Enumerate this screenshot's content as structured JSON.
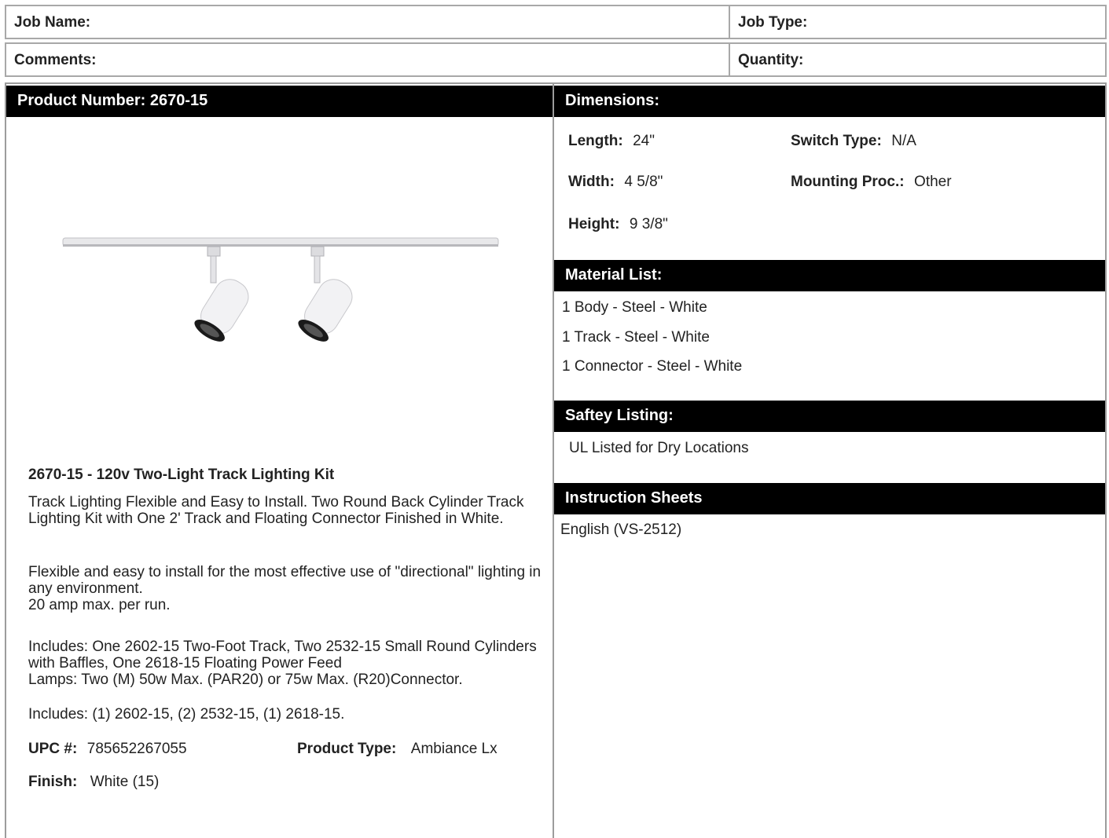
{
  "job": {
    "job_name_label": "Job Name:",
    "job_type_label": "Job Type:",
    "comments_label": "Comments:",
    "quantity_label": "Quantity:"
  },
  "product": {
    "header": "Product Number: 2670-15",
    "title": "2670-15 - 120v Two-Light Track Lighting Kit",
    "desc1": "Track Lighting Flexible and Easy to Install. Two Round Back Cylinder Track Lighting Kit with One 2' Track and Floating Connector Finished in White.",
    "desc2_line1": "Flexible and easy to install for the most effective use of \"directional\" lighting in any environment.",
    "desc2_line2": "20 amp max. per run.",
    "desc3_line1": "Includes: One 2602-15 Two-Foot Track, Two 2532-15 Small Round Cylinders with Baffles, One 2618-15 Floating Power Feed",
    "desc3_line2": "Lamps: Two (M) 50w Max. (PAR20) or 75w Max. (R20)Connector.",
    "desc4": "Includes: (1) 2602-15, (2) 2532-15, (1) 2618-15.",
    "upc_label": "UPC #:",
    "upc_value": "785652267055",
    "type_label": "Product Type:",
    "type_value": "Ambiance Lx",
    "finish_label": "Finish:",
    "finish_value": "White (15)"
  },
  "dimensions": {
    "header": "Dimensions:",
    "length_label": "Length:",
    "length_value": "24\"",
    "width_label": "Width:",
    "width_value": "4 5/8\"",
    "height_label": "Height:",
    "height_value": "9 3/8\"",
    "switch_label": "Switch Type:",
    "switch_value": "N/A",
    "mounting_label": "Mounting Proc.:",
    "mounting_value": "Other"
  },
  "materials": {
    "header": "Material List:",
    "items": [
      "1 Body - Steel - White",
      "1 Track - Steel - White",
      "1 Connector - Steel - White"
    ]
  },
  "safety": {
    "header": "Saftey Listing:",
    "text": "UL Listed for Dry Locations"
  },
  "instructions": {
    "header": "Instruction Sheets",
    "link": "English (VS-2512)"
  },
  "icons": {
    "product_image": "track-light-kit-image"
  }
}
